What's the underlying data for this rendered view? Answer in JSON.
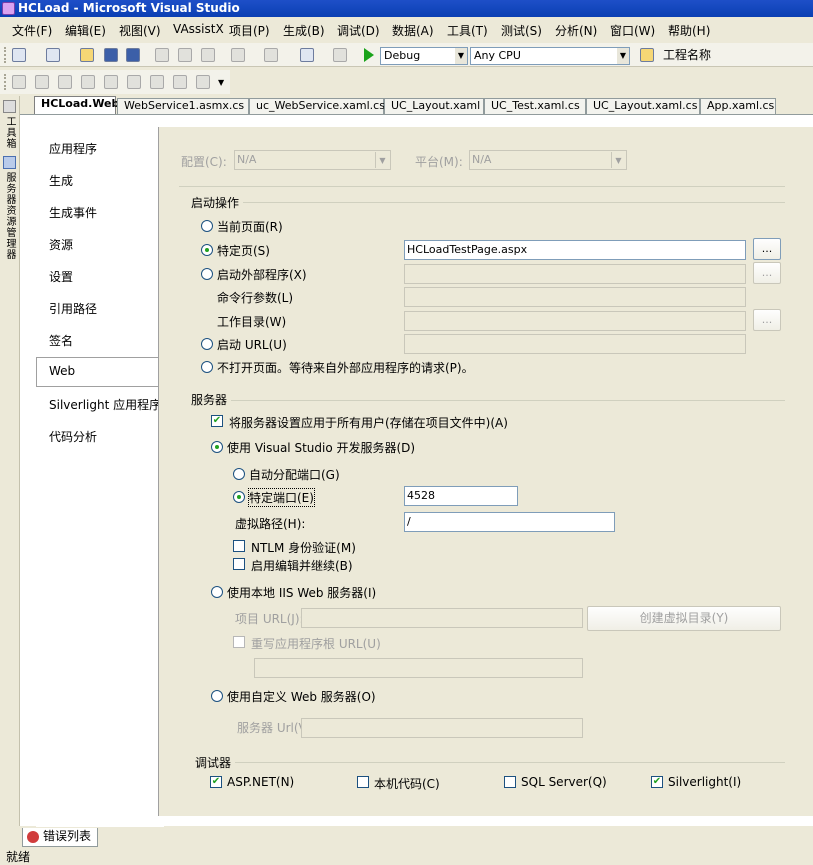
{
  "window": {
    "title": "HCLoad - Microsoft Visual Studio"
  },
  "menu": [
    "文件(F)",
    "编辑(E)",
    "视图(V)",
    "VAssistX",
    "项目(P)",
    "生成(B)",
    "调试(D)",
    "数据(A)",
    "工具(T)",
    "测试(S)",
    "分析(N)",
    "窗口(W)",
    "帮助(H)"
  ],
  "toolbar": {
    "config": "Debug",
    "platform": "Any CPU",
    "project_name_label": "工程名称"
  },
  "side_tools": {
    "toolbox": "工具箱",
    "server_explorer": "服务器资源管理器"
  },
  "tabs": [
    "HCLoad.Web",
    "WebService1.asmx.cs",
    "uc_WebService.xaml.cs",
    "UC_Layout.xaml",
    "UC_Test.xaml.cs",
    "UC_Layout.xaml.cs",
    "App.xaml.cs"
  ],
  "nav": [
    "应用程序",
    "生成",
    "生成事件",
    "资源",
    "设置",
    "引用路径",
    "签名",
    "Web",
    "Silverlight 应用程序",
    "代码分析"
  ],
  "config_row": {
    "config_label": "配置(C):",
    "config_value": "N/A",
    "platform_label": "平台(M):",
    "platform_value": "N/A"
  },
  "start_action": {
    "title": "启动操作",
    "current_page": "当前页面(R)",
    "specific_page": "特定页(S)",
    "specific_page_value": "HCLoadTestPage.aspx",
    "external_program": "启动外部程序(X)",
    "cmd_args": "命令行参数(L)",
    "working_dir": "工作目录(W)",
    "start_url": "启动 URL(U)",
    "dont_open": "不打开页面。等待来自外部应用程序的请求(P)。",
    "browse": "..."
  },
  "servers": {
    "title": "服务器",
    "apply_all": "将服务器设置应用于所有用户(存储在项目文件中)(A)",
    "vs_dev_server": "使用 Visual Studio 开发服务器(D)",
    "auto_port": "自动分配端口(G)",
    "specific_port": "特定端口(E)",
    "port_value": "4528",
    "virtual_path": "虚拟路径(H):",
    "virtual_path_value": "/",
    "ntlm": "NTLM 身份验证(M)",
    "edit_continue": "启用编辑并继续(B)",
    "iis_server": "使用本地 IIS Web 服务器(I)",
    "project_url": "项目 URL(J):",
    "create_vdir": "创建虚拟目录(Y)",
    "override_root": "重写应用程序根 URL(U)",
    "custom_server": "使用自定义 Web 服务器(O)",
    "server_url": "服务器 Url(V)"
  },
  "debuggers": {
    "title": "调试器",
    "aspnet": "ASP.NET(N)",
    "native": "本机代码(C)",
    "sql": "SQL Server(Q)",
    "silverlight": "Silverlight(I)"
  },
  "bottom": {
    "error_list": "错误列表",
    "status": "就绪"
  }
}
